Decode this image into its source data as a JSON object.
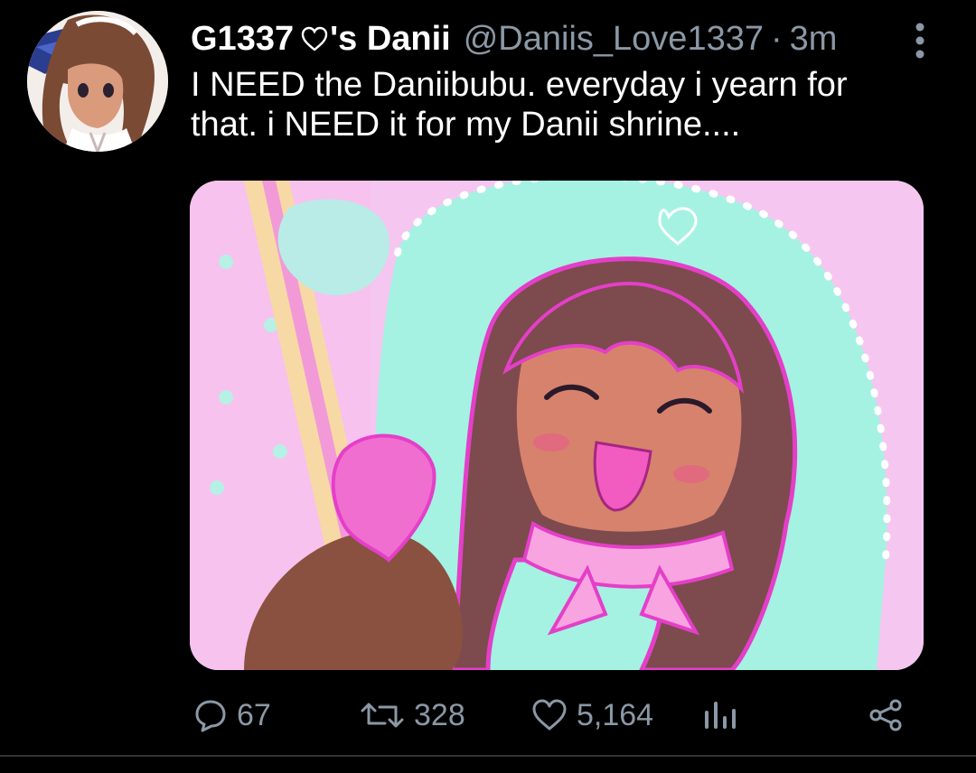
{
  "tweet": {
    "display_name_prefix": "G1337",
    "display_name_suffix": "'s Danii",
    "handle": "@Daniis_Love1337",
    "separator": "·",
    "time": "3m",
    "text": "I NEED the Daniibubu. everyday i yearn for\nthat. i NEED it for my Danii shrine....",
    "avatar_icon": "profile-avatar",
    "media_icon": "anime-character-illustration"
  },
  "actions": {
    "reply_count": "67",
    "retweet_count": "328",
    "like_count": "5,164"
  },
  "icons": {
    "reply": "speech-bubble",
    "retweet": "retweet-arrows",
    "like": "heart-outline",
    "analytics": "bar-chart",
    "share": "share-nodes",
    "more": "vertical-ellipsis"
  },
  "colors": {
    "background": "#000000",
    "text": "#ffffff",
    "muted": "#8b98a5",
    "divider": "#2f3336"
  }
}
